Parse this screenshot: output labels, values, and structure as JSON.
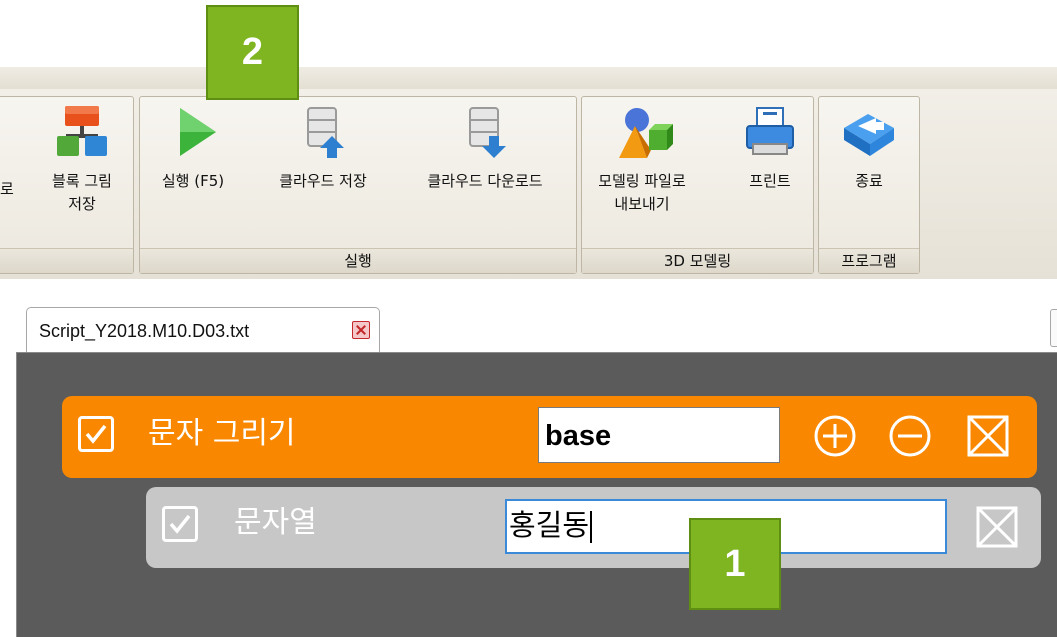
{
  "ribbon": {
    "partial_left_label": "로",
    "block_image_save": {
      "line1": "블록 그림",
      "line2": "저장"
    },
    "run_group": {
      "label": "실행",
      "buttons": [
        {
          "label": "실행 (F5)",
          "icon": "play-icon"
        },
        {
          "label": "클라우드 저장",
          "icon": "cloud-upload-icon"
        },
        {
          "label": "클라우드 다운로드",
          "icon": "cloud-download-icon"
        }
      ]
    },
    "modeling_group": {
      "label": "3D 모델링",
      "buttons": [
        {
          "line1": "모델링 파일로",
          "line2": "내보내기",
          "icon": "3d-shapes-icon"
        },
        {
          "label": "프린트",
          "icon": "printer-icon"
        }
      ]
    },
    "program_group": {
      "label": "프로그램",
      "buttons": [
        {
          "label": "종료",
          "icon": "exit-icon"
        }
      ]
    }
  },
  "tab": {
    "title": "Script_Y2018.M10.D03.txt"
  },
  "blocks": [
    {
      "label": "문자 그리기",
      "input_value": "base",
      "color": "#f98800",
      "checked": true
    },
    {
      "label": "문자열",
      "input_value": "홍길동",
      "color": "#c7c7c7",
      "checked": true
    }
  ],
  "markers": {
    "m1": "1",
    "m2": "2"
  },
  "colors": {
    "marker": "#7fb521",
    "orange_block": "#f98800",
    "gray_block": "#c7c7c7",
    "editor_bg": "#5b5b5b"
  }
}
